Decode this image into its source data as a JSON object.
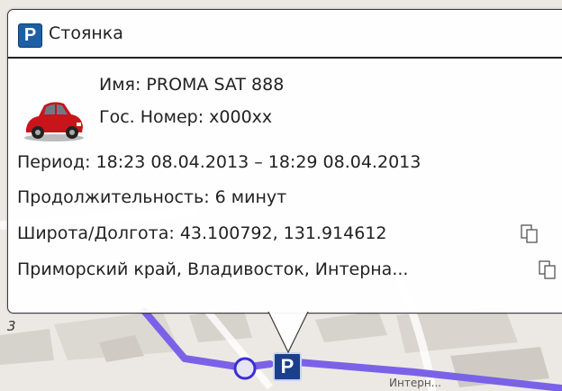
{
  "popup": {
    "title": "Стоянка",
    "parking_letter": "P",
    "name_line": "Имя: PROMA SAT  888",
    "plate_line": "Гос. Номер: х000хх",
    "period_line": "Период: 18:23 08.04.2013 – 18:29 08.04.2013",
    "duration_line": "Продолжительность: 6 минут",
    "coords_line": "Широта/Долгота: 43.100792, 131.914612",
    "address_line": "Приморский край, Владивосток, Интерна..."
  },
  "map": {
    "marker_letter": "P",
    "street_label": "Интерн...",
    "digit_label": "3",
    "route_color": "#7a62e8",
    "marker_color": "#1b3f8a"
  },
  "icons": [
    "parking-icon",
    "car-icon",
    "copy-icon"
  ]
}
